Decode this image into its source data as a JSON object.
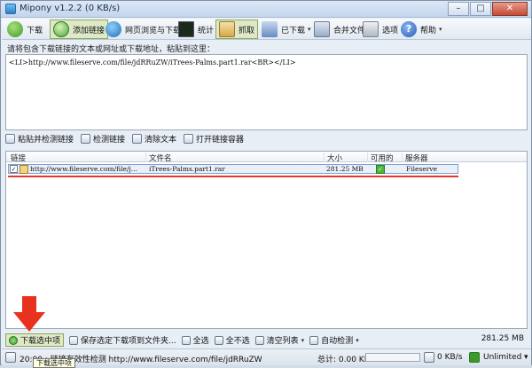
{
  "app": {
    "title": "Mipony v1.2.2 (0 KB/s)"
  },
  "window_buttons": {
    "minimize": "–",
    "maximize": "□",
    "close": "✕"
  },
  "toolbar": {
    "items": [
      {
        "label": "下载",
        "icon": "download-icon"
      },
      {
        "label": "添加链接",
        "icon": "add-link-icon"
      },
      {
        "label": "网页浏览与下载",
        "icon": "globe-icon"
      },
      {
        "label": "统计",
        "icon": "stats-icon"
      },
      {
        "label": "抓取",
        "icon": "grab-icon"
      },
      {
        "label": "已下载",
        "icon": "downloaded-icon"
      },
      {
        "label": "合并文件",
        "icon": "merge-icon"
      },
      {
        "label": "选项",
        "icon": "options-icon"
      },
      {
        "label": "帮助",
        "icon": "help-icon"
      }
    ]
  },
  "prompt": "请将包含下载链接的文本或网址或下载地址，粘贴到这里：",
  "textarea": {
    "value": "<LI>http://www.fileserve.com/file/jdRRuZW/iTrees-Palms.part1.rar<BR></LI>"
  },
  "actions": [
    {
      "label": "粘贴并检测链接",
      "icon": "paste-icon"
    },
    {
      "label": "检测链接",
      "icon": "check-link-icon"
    },
    {
      "label": "清除文本",
      "icon": "clear-text-icon"
    },
    {
      "label": "打开链接容器",
      "icon": "open-container-icon"
    }
  ],
  "table": {
    "headers": [
      "链接",
      "文件名",
      "大小",
      "可用的",
      "服务器"
    ],
    "rows": [
      {
        "checked": "✓",
        "link": "http://www.fileserve.com/file/j...",
        "filename": "iTrees-Palms.part1.rar",
        "size": "281.25 MB",
        "available": "✓",
        "server": "Fileserve"
      }
    ]
  },
  "bottom_actions": [
    {
      "label": "下载选中项",
      "icon": "download-selected-icon"
    },
    {
      "label": "保存选定下载项到文件夹...",
      "icon": "save-folder-icon"
    },
    {
      "label": "全选",
      "icon": "select-all-icon"
    },
    {
      "label": "全不选",
      "icon": "deselect-all-icon"
    },
    {
      "label": "清空列表",
      "icon": "clear-list-icon",
      "caret": "▾"
    },
    {
      "label": "自动检测",
      "icon": "auto-detect-icon",
      "caret": "▾"
    }
  ],
  "total_size": "281.25 MB",
  "status": {
    "message": "20:00 : 链接有效性检测 http://www.fileserve.com/file/jdRRuZW",
    "total": "总计: 0.00 KB",
    "progress_value": 0,
    "download_speed": "0 KB/s",
    "upload_speed": "0 KB/s",
    "limit": "Unlimited",
    "limit_caret": "▾"
  },
  "tooltip": "下载选中项",
  "colors": {
    "arrow": "#e8321e",
    "underline": "#e23a2a",
    "selected_row": "#e9f0fa"
  }
}
